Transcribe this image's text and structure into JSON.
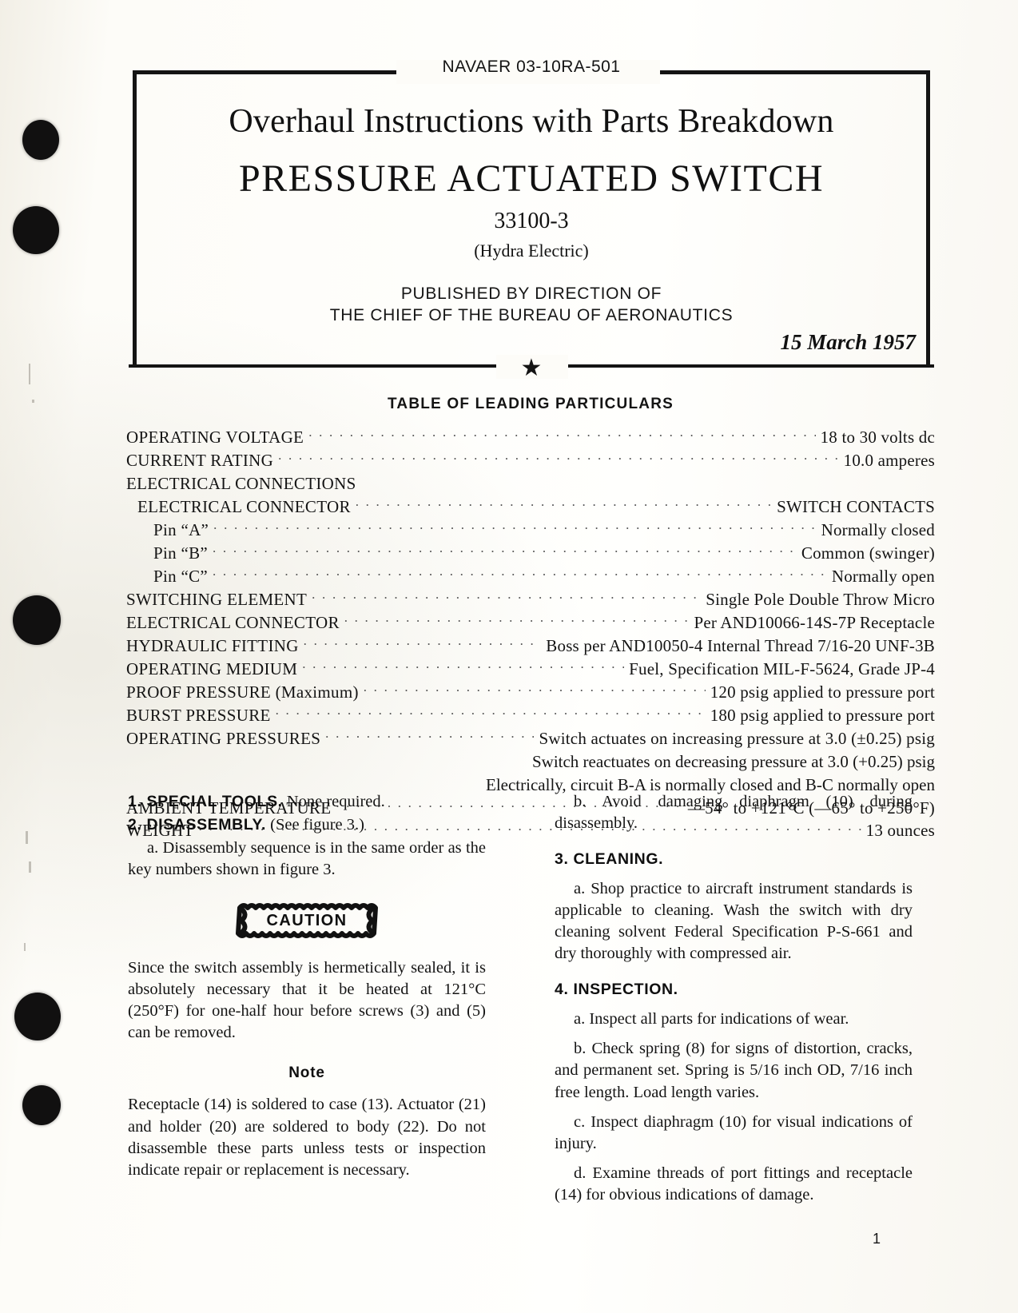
{
  "header": {
    "doc_number": "NAVAER 03-10RA-501",
    "title": "Overhaul Instructions with Parts Breakdown",
    "subject": "PRESSURE ACTUATED SWITCH",
    "part_number": "33100-3",
    "manufacturer": "(Hydra Electric)",
    "published_line1": "PUBLISHED BY DIRECTION OF",
    "published_line2": "THE CHIEF OF THE BUREAU OF AERONAUTICS",
    "date": "15 March 1957",
    "star_glyph": "★"
  },
  "table": {
    "heading": "TABLE OF LEADING PARTICULARS",
    "rows": [
      {
        "label": "OPERATING VOLTAGE",
        "value": "18 to 30 volts dc",
        "indent": 0,
        "dots": true
      },
      {
        "label": "CURRENT RATING",
        "value": "10.0 amperes",
        "indent": 0,
        "dots": true
      },
      {
        "label": "ELECTRICAL CONNECTIONS",
        "value": "",
        "indent": 0,
        "dots": false
      },
      {
        "label": "ELECTRICAL CONNECTOR",
        "value": "SWITCH CONTACTS",
        "indent": 1,
        "dots": true
      },
      {
        "label": "Pin “A”",
        "value": "Normally closed",
        "indent": 2,
        "dots": true
      },
      {
        "label": "Pin “B”",
        "value": "Common   (swinger)",
        "indent": 2,
        "dots": true
      },
      {
        "label": "Pin “C”",
        "value": "Normally open",
        "indent": 2,
        "dots": true
      },
      {
        "label": "SWITCHING ELEMENT",
        "value": "Single Pole Double Throw Micro",
        "indent": 0,
        "dots": true
      },
      {
        "label": "ELECTRICAL  CONNECTOR",
        "value": "Per  AND10066-14S-7P  Receptacle",
        "indent": 0,
        "dots": true
      },
      {
        "label": "HYDRAULIC  FITTING",
        "value": "Boss per AND10050-4 Internal Thread 7/16-20 UNF-3B",
        "indent": 0,
        "dots": true
      },
      {
        "label": "OPERATING  MEDIUM",
        "value": "Fuel, Specification MIL-F-5624, Grade JP-4",
        "indent": 0,
        "dots": true
      },
      {
        "label": "PROOF PRESSURE (Maximum)",
        "value": "120 psig applied to pressure port",
        "indent": 0,
        "dots": true
      },
      {
        "label": "BURST PRESSURE",
        "value": "180 psig applied to pressure port",
        "indent": 0,
        "dots": true
      },
      {
        "label": "OPERATING  PRESSURES",
        "value": "Switch actuates on increasing pressure at 3.0 (±0.25) psig",
        "indent": 0,
        "dots": true
      }
    ],
    "continuation_lines": [
      "Switch reactuates on decreasing pressure at 3.0 (+0.25) psig",
      "Electrically, circuit B-A is normally closed and B-C normally open"
    ],
    "rows_tail": [
      {
        "label": "AMBIENT TEMPERATURE",
        "value": "—54° to +121°C (—65° to +250°F)",
        "indent": 0,
        "dots": true
      },
      {
        "label": "WEIGHT",
        "value": "13 ounces",
        "indent": 0,
        "dots": true
      }
    ]
  },
  "left_column": {
    "s1_num": "1. SPECIAL TOOLS.",
    "s1_text": "None required.",
    "s2_num": "2. DISASSEMBLY.",
    "s2_text": "(See figure 3.)",
    "s2a": "a. Disassembly sequence is in the same order as the key numbers shown in figure 3.",
    "caution_label": "CAUTION",
    "caution_body": "Since the switch assembly is hermetically sealed, it is absolutely necessary that it be heated at 121°C (250°F) for one-half hour before screws (3) and (5) can be removed.",
    "note_label": "Note",
    "note_body": "Receptacle (14) is soldered to case (13). Actuator (21) and holder (20) are soldered to body (22). Do not disassemble these parts unless tests or inspection indicate repair or replacement is necessary."
  },
  "right_column": {
    "s2b": "b. Avoid damaging diaphragm (10) during disassembly.",
    "s3_num": "3. CLEANING.",
    "s3a": "a. Shop practice to aircraft instrument standards is applicable to cleaning. Wash the switch with dry cleaning solvent Federal Specification P-S-661 and dry thoroughly with compressed air.",
    "s4_num": "4. INSPECTION.",
    "s4a": "a. Inspect all parts for indications of wear.",
    "s4b": "b. Check spring (8) for signs of distortion, cracks, and permanent set. Spring is 5/16 inch OD, 7/16 inch free length. Load length varies.",
    "s4c": "c. Inspect diaphragm (10) for visual indications of injury.",
    "s4d": "d. Examine threads of port fittings and receptacle (14) for obvious indications of damage."
  },
  "footer": {
    "page_number": "1"
  }
}
